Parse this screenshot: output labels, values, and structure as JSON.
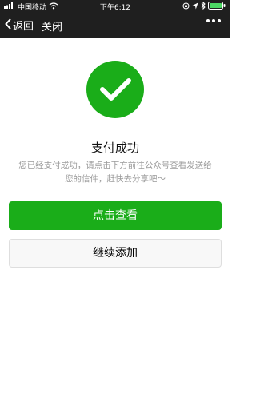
{
  "status_bar": {
    "carrier": "中国移动",
    "time": "下午6:12"
  },
  "nav": {
    "back_label": "返回",
    "close_label": "关闭"
  },
  "result": {
    "title": "支付成功",
    "description_line1": "您已经支付成功，请点击下方前往公众号查看发送给",
    "description_line2": "您的信件，赶快去分享吧～"
  },
  "actions": {
    "primary_label": "点击查看",
    "secondary_label": "继续添加"
  },
  "colors": {
    "accent": "#1aad19",
    "header_bg": "#1f1f1f"
  }
}
